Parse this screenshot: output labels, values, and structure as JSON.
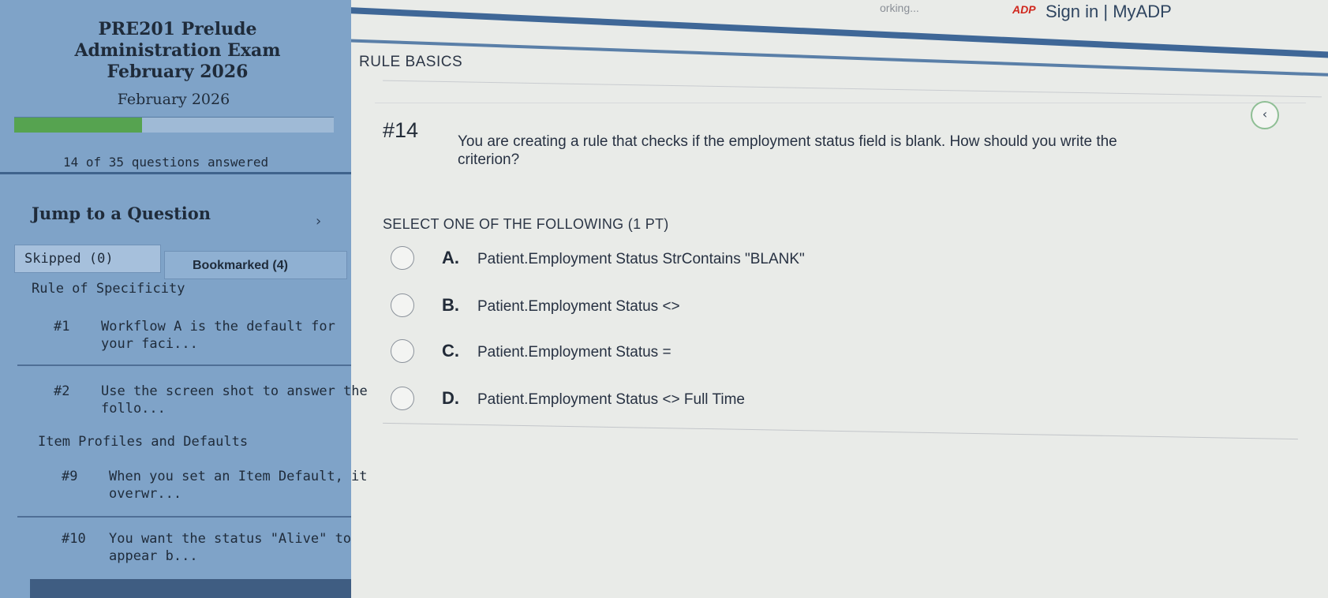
{
  "topbar": {
    "status_text": "orking...",
    "adp_logo": "ADP",
    "signin_label": "Sign in | MyADP"
  },
  "sidebar": {
    "exam_title": "PRE201 Prelude Administration Exam February 2026",
    "exam_date": "February 2026",
    "progress": {
      "answered": 14,
      "total": 35,
      "fraction": 0.4,
      "label": "14 of 35 questions answered"
    },
    "jump_title": "Jump to a Question",
    "tabs": {
      "skipped": "Skipped (0)",
      "bookmarked": "Bookmarked (4)"
    },
    "groups": [
      {
        "header": "Rule of Specificity",
        "items": [
          {
            "num": "#1",
            "text": "Workflow A is the default for your faci..."
          },
          {
            "num": "#2",
            "text": "Use the screen shot to answer the follo..."
          }
        ]
      },
      {
        "header": "Item Profiles and Defaults",
        "items": [
          {
            "num": "#9",
            "text": "When you set an Item Default, it overwr..."
          },
          {
            "num": "#10",
            "text": "You want the status \"Alive\" to appear b..."
          }
        ]
      }
    ]
  },
  "main": {
    "section_title": "RULE BASICS",
    "collapse_icon": "chevron-left-icon",
    "question": {
      "number": "#14",
      "text_line1": "You are creating a rule that checks if the employment status field is blank. How should you write the",
      "text_line2": "criterion?"
    },
    "select_label": "SELECT ONE OF THE FOLLOWING (1 PT)",
    "options": [
      {
        "letter": "A.",
        "text": "Patient.Employment Status StrContains \"BLANK\""
      },
      {
        "letter": "B.",
        "text": "Patient.Employment Status <>"
      },
      {
        "letter": "C.",
        "text": "Patient.Employment Status ="
      },
      {
        "letter": "D.",
        "text": "Patient.Employment Status <> Full Time"
      }
    ]
  },
  "colors": {
    "sidebar_bg": "#7fa3c8",
    "progress_fill": "#56a350",
    "main_bg": "#e9ebe8",
    "accent_blue": "#3f6797"
  }
}
